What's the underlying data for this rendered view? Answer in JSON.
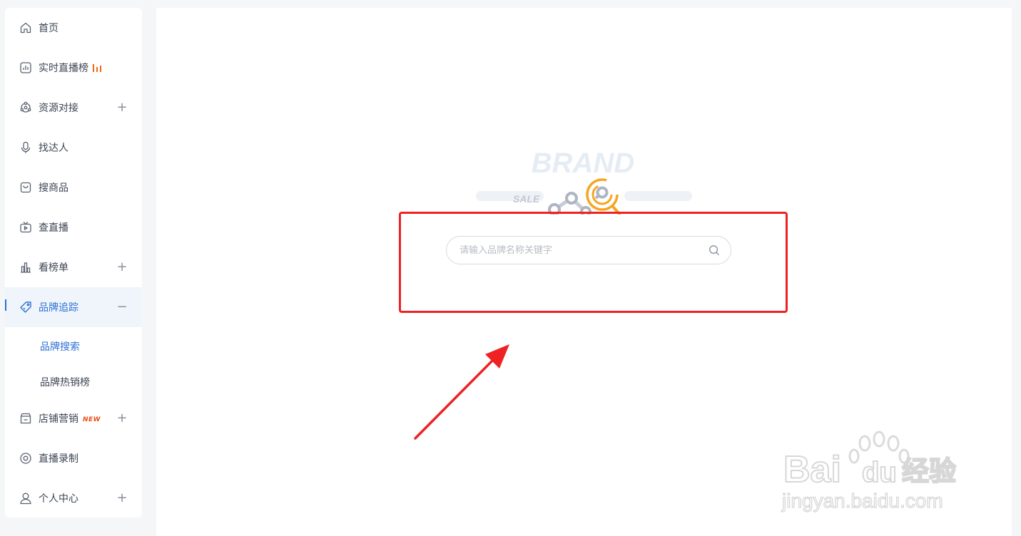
{
  "sidebar": {
    "items": [
      {
        "label": "首页",
        "icon": "home-icon",
        "toggle": ""
      },
      {
        "label": "实时直播榜",
        "icon": "chart-box-icon",
        "toggle": ""
      },
      {
        "label": "资源对接",
        "icon": "network-icon",
        "toggle": "+"
      },
      {
        "label": "找达人",
        "icon": "microphone-icon",
        "toggle": ""
      },
      {
        "label": "搜商品",
        "icon": "shopping-bag-icon",
        "toggle": ""
      },
      {
        "label": "查直播",
        "icon": "tv-icon",
        "toggle": ""
      },
      {
        "label": "看榜单",
        "icon": "bar-chart-icon",
        "toggle": "+"
      },
      {
        "label": "品牌追踪",
        "icon": "tag-icon",
        "toggle": "−"
      },
      {
        "label": "店铺营销",
        "icon": "store-icon",
        "toggle": "+",
        "badge": "NEW"
      },
      {
        "label": "直播录制",
        "icon": "record-icon",
        "toggle": ""
      },
      {
        "label": "个人中心",
        "icon": "user-icon",
        "toggle": "+"
      }
    ],
    "sub_items": [
      {
        "label": "品牌搜索"
      },
      {
        "label": "品牌热销榜"
      }
    ]
  },
  "main": {
    "search": {
      "placeholder": "请输入品牌名称关键字",
      "value": ""
    },
    "illustration": {
      "brand_text": "BRAND",
      "sale_text": "SALE"
    }
  },
  "watermark": {
    "brand": "Bai",
    "brand2": "du",
    "cn": "经验",
    "url": "jingyan.baidu.com"
  },
  "colors": {
    "accent": "#2b6fd6",
    "highlight": "#ee2222",
    "orange": "#f5a623"
  }
}
